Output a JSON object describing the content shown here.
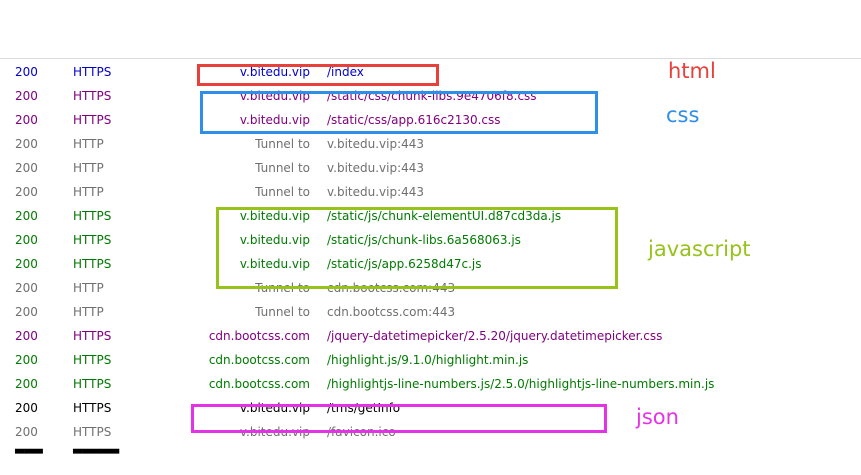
{
  "colors": {
    "https_html": "#0000cc",
    "https_css": "#800080",
    "http_tunnel": "#707070",
    "https_js": "#007a00",
    "https_json": "#000000",
    "https_icon": "#707070",
    "box_html": "#e8413c",
    "box_css": "#2f8ee8",
    "box_js": "#96c21a",
    "box_json": "#e632e6"
  },
  "sessions": [
    {
      "result": "200",
      "protocol": "HTTPS",
      "host": "v.bitedu.vip",
      "url": "/index"
    },
    {
      "result": "200",
      "protocol": "HTTPS",
      "host": "v.bitedu.vip",
      "url": "/static/css/chunk-libs.9e4706f8.css"
    },
    {
      "result": "200",
      "protocol": "HTTPS",
      "host": "v.bitedu.vip",
      "url": "/static/css/app.616c2130.css"
    },
    {
      "result": "200",
      "protocol": "HTTP",
      "host": "Tunnel to",
      "url": "v.bitedu.vip:443"
    },
    {
      "result": "200",
      "protocol": "HTTP",
      "host": "Tunnel to",
      "url": "v.bitedu.vip:443"
    },
    {
      "result": "200",
      "protocol": "HTTP",
      "host": "Tunnel to",
      "url": "v.bitedu.vip:443"
    },
    {
      "result": "200",
      "protocol": "HTTPS",
      "host": "v.bitedu.vip",
      "url": "/static/js/chunk-elementUI.d87cd3da.js"
    },
    {
      "result": "200",
      "protocol": "HTTPS",
      "host": "v.bitedu.vip",
      "url": "/static/js/chunk-libs.6a568063.js"
    },
    {
      "result": "200",
      "protocol": "HTTPS",
      "host": "v.bitedu.vip",
      "url": "/static/js/app.6258d47c.js"
    },
    {
      "result": "200",
      "protocol": "HTTP",
      "host": "Tunnel to",
      "url": "cdn.bootcss.com:443"
    },
    {
      "result": "200",
      "protocol": "HTTP",
      "host": "Tunnel to",
      "url": "cdn.bootcss.com:443"
    },
    {
      "result": "200",
      "protocol": "HTTPS",
      "host": "cdn.bootcss.com",
      "url": "/jquery-datetimepicker/2.5.20/jquery.datetimepicker.css"
    },
    {
      "result": "200",
      "protocol": "HTTPS",
      "host": "cdn.bootcss.com",
      "url": "/highlight.js/9.1.0/highlight.min.js"
    },
    {
      "result": "200",
      "protocol": "HTTPS",
      "host": "cdn.bootcss.com",
      "url": "/highlightjs-line-numbers.js/2.5.0/highlightjs-line-numbers.min.js"
    },
    {
      "result": "200",
      "protocol": "HTTPS",
      "host": "v.bitedu.vip",
      "url": "/tms/getInfo"
    },
    {
      "result": "200",
      "protocol": "HTTPS",
      "host": "v.bitedu.vip",
      "url": "/favicon.ico"
    }
  ],
  "annotations": {
    "html": "html",
    "css": "css",
    "javascript": "javascript",
    "json": "json"
  }
}
